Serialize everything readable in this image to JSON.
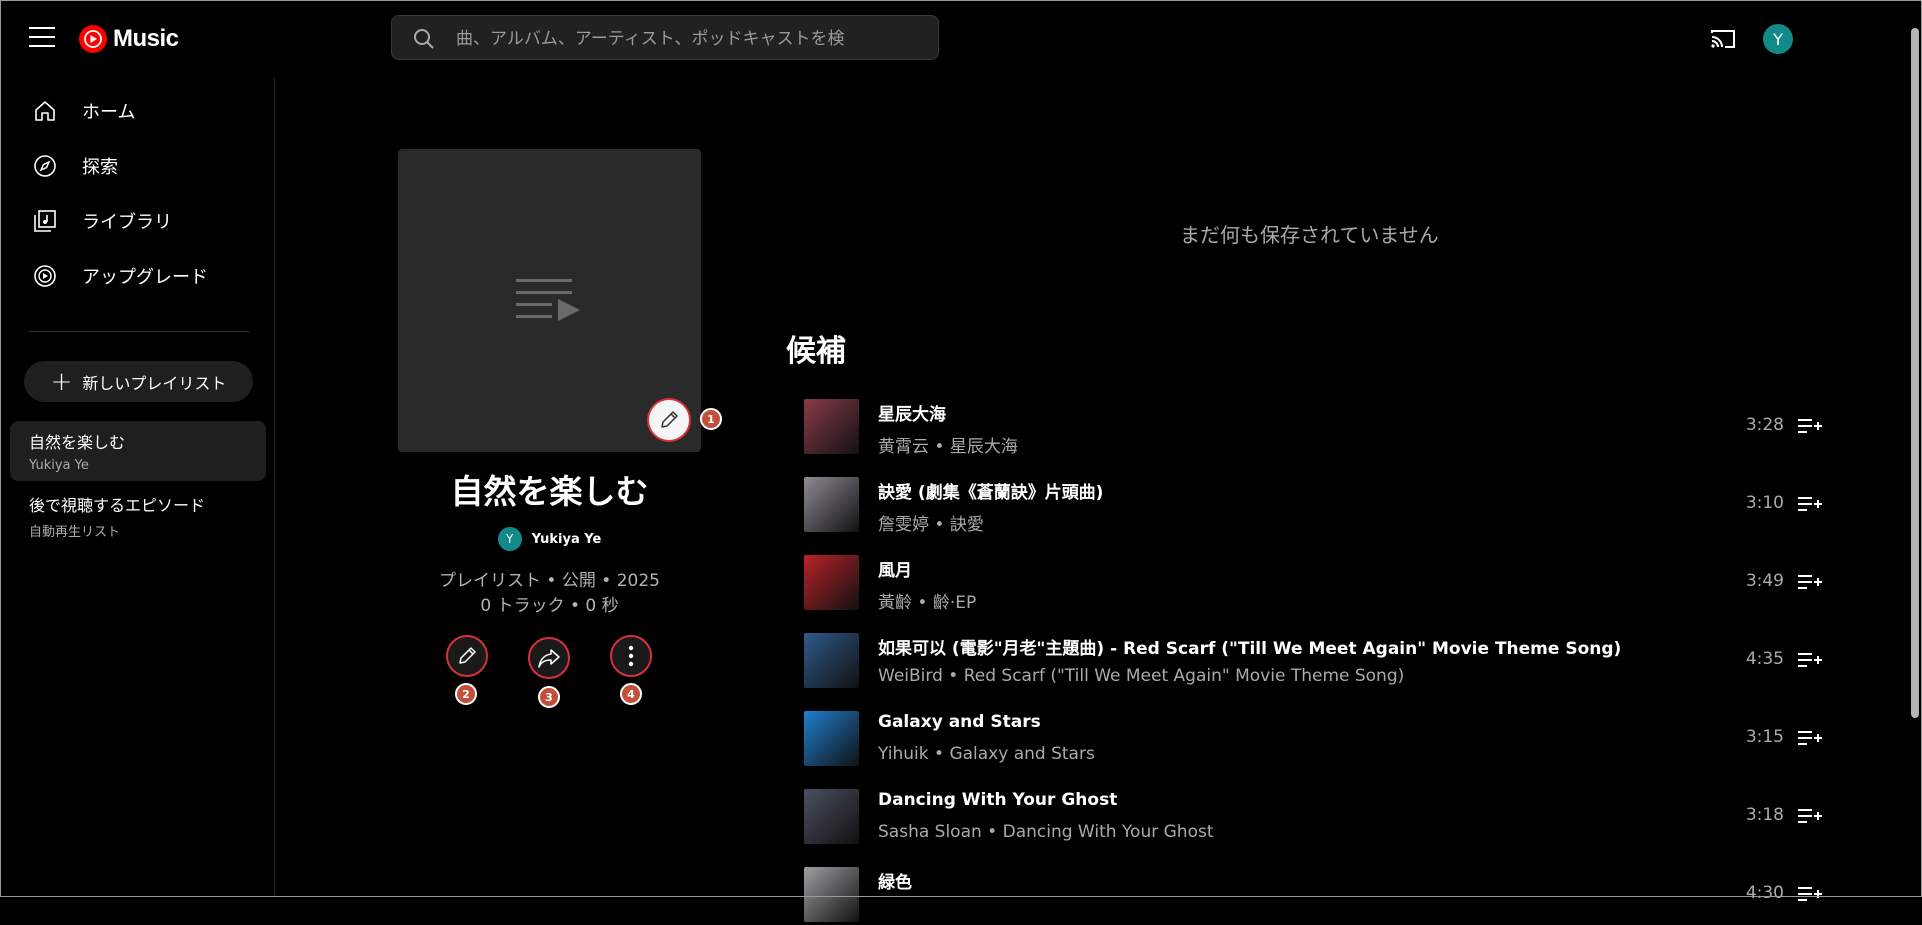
{
  "header": {
    "logo_text": "Music",
    "search_placeholder": "曲、アルバム、アーティスト、ポッドキャストを検",
    "avatar_letter": "Y"
  },
  "sidebar": {
    "nav": [
      {
        "label": "ホーム",
        "icon": "home-icon"
      },
      {
        "label": "探索",
        "icon": "compass-icon"
      },
      {
        "label": "ライブラリ",
        "icon": "library-icon"
      },
      {
        "label": "アップグレード",
        "icon": "upgrade-icon"
      }
    ],
    "new_playlist_label": "新しいプレイリスト",
    "playlists": [
      {
        "title": "自然を楽しむ",
        "subtitle": "Yukiya Ye"
      },
      {
        "title": "後で視聴するエピソード",
        "subtitle": "自動再生リスト"
      }
    ]
  },
  "playlist": {
    "title": "自然を楽しむ",
    "owner_letter": "Y",
    "owner_name": "Yukiya Ye",
    "meta_line1": "プレイリスト • 公開 • 2025",
    "meta_line2": "0 トラック • 0 秒",
    "badges": [
      "1",
      "2",
      "3",
      "4"
    ]
  },
  "main": {
    "empty_message": "まだ何も保存されていません",
    "suggestions_title": "候補",
    "tracks": [
      {
        "title": "星辰大海",
        "subtitle": "黄霄云 • 星辰大海",
        "duration": "3:28",
        "color": "#8a3b4a"
      },
      {
        "title": "訣愛 (劇集《蒼蘭訣》片頭曲)",
        "subtitle": "詹雯婷 • 訣愛",
        "duration": "3:10",
        "color": "#8e8a95"
      },
      {
        "title": "風月",
        "subtitle": "黃齡 • 齡·EP",
        "duration": "3:49",
        "color": "#b8222a"
      },
      {
        "title": "如果可以 (電影\"月老\"主題曲) - Red Scarf (\"Till We Meet Again\" Movie Theme Song)",
        "subtitle": "WeiBird • Red Scarf (\"Till We Meet Again\" Movie Theme Song)",
        "duration": "4:35",
        "color": "#2f5a8a"
      },
      {
        "title": "Galaxy and Stars",
        "subtitle": "Yihuik • Galaxy and Stars",
        "duration": "3:15",
        "color": "#1e7fd0"
      },
      {
        "title": "Dancing With Your Ghost",
        "subtitle": "Sasha Sloan • Dancing With Your Ghost",
        "duration": "3:18",
        "color": "#4a5060"
      },
      {
        "title": "緑色",
        "subtitle": "",
        "duration": "4:30",
        "color": "#9aa0a0"
      }
    ]
  },
  "colors": {
    "accent": "#ff0000",
    "highlight_ring": "#d8303a",
    "badge": "#c0503a",
    "avatar": "#138a8a"
  }
}
